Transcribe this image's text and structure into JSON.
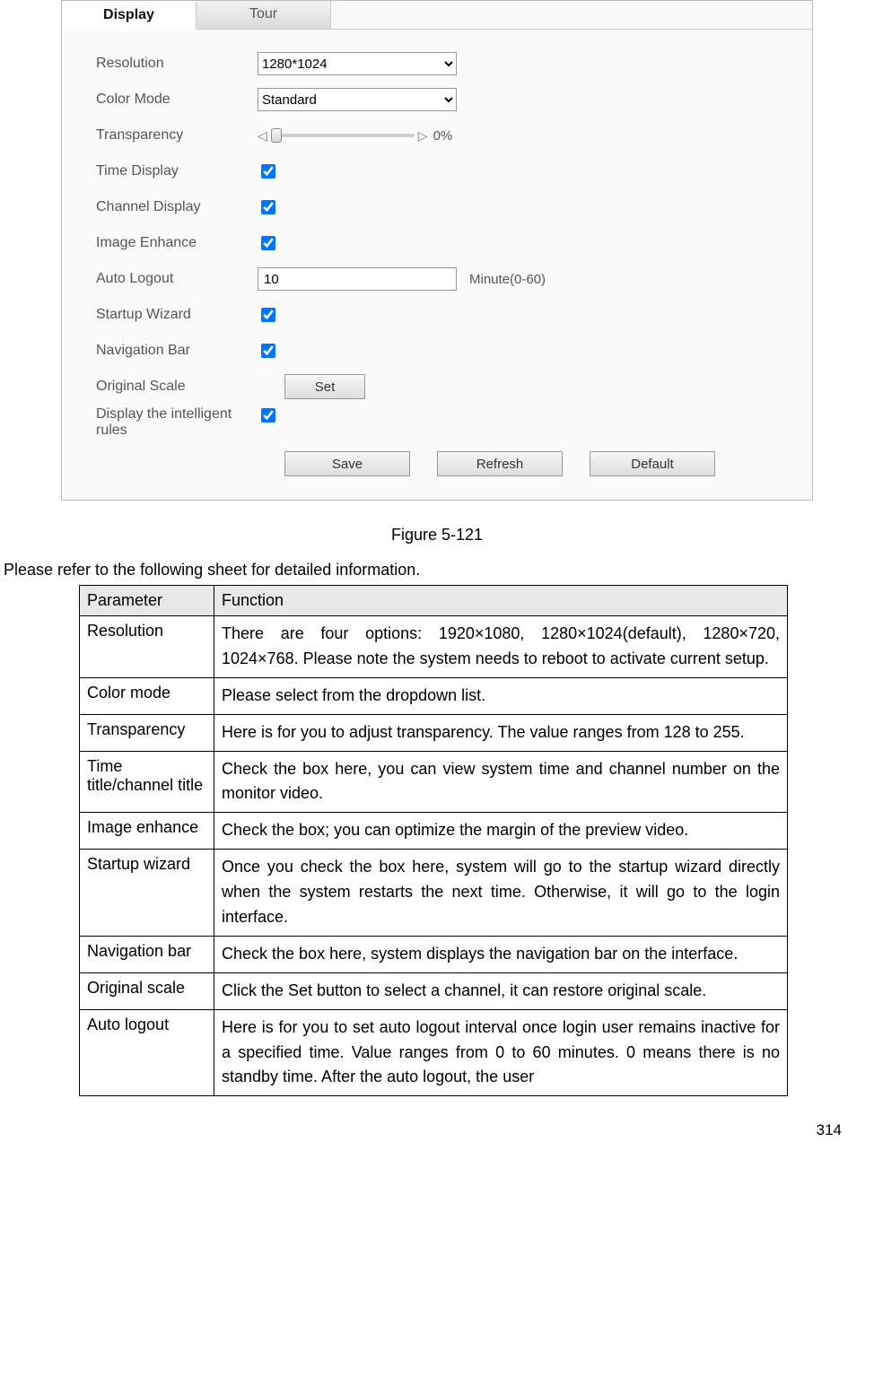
{
  "tabs": {
    "display": "Display",
    "tour": "Tour"
  },
  "labels": {
    "resolution": "Resolution",
    "color_mode": "Color Mode",
    "transparency": "Transparency",
    "time_display": "Time Display",
    "channel_display": "Channel Display",
    "image_enhance": "Image Enhance",
    "auto_logout": "Auto Logout",
    "startup_wizard": "Startup Wizard",
    "navigation_bar": "Navigation Bar",
    "original_scale": "Original Scale",
    "intelligent_rules": "Display the intelligent rules"
  },
  "values": {
    "resolution": "1280*1024",
    "color_mode": "Standard",
    "transparency_pct": "0%",
    "auto_logout": "10",
    "auto_logout_unit": "Minute(0-60)"
  },
  "buttons": {
    "set": "Set",
    "save": "Save",
    "refresh": "Refresh",
    "default": "Default"
  },
  "caption": "Figure 5-121",
  "lead": "Please refer to the following sheet for detailed information.",
  "table": {
    "head": {
      "param": "Parameter",
      "func": "Function"
    },
    "rows": [
      {
        "param": "Resolution",
        "func": "There are four options: 1920×1080, 1280×1024(default), 1280×720, 1024×768. Please note the system needs to reboot to activate current setup."
      },
      {
        "param": "Color mode",
        "func": "Please select from the dropdown list."
      },
      {
        "param": "Transparency",
        "func": "Here is for you to adjust transparency. The value ranges from 128 to 255."
      },
      {
        "param": "Time title/channel title",
        "func": "Check the box here, you can view system time and channel number on the monitor video."
      },
      {
        "param": "Image enhance",
        "func": "Check the box; you can optimize the margin of the preview video."
      },
      {
        "param": "Startup wizard",
        "func": "Once you check the box here, system will go to the startup wizard directly when the system restarts the next time. Otherwise, it will go to the login interface."
      },
      {
        "param": "Navigation bar",
        "func": "Check the box here, system displays the navigation bar on the interface."
      },
      {
        "param": "Original scale",
        "func": "Click the Set button to select a channel, it can restore original scale."
      },
      {
        "param": "Auto logout",
        "func": "Here is for you to set auto logout interval once login user remains inactive for a specified time. Value ranges from 0 to 60 minutes. 0 means there is no standby time. After the auto logout, the user"
      }
    ]
  },
  "page_number": "314"
}
